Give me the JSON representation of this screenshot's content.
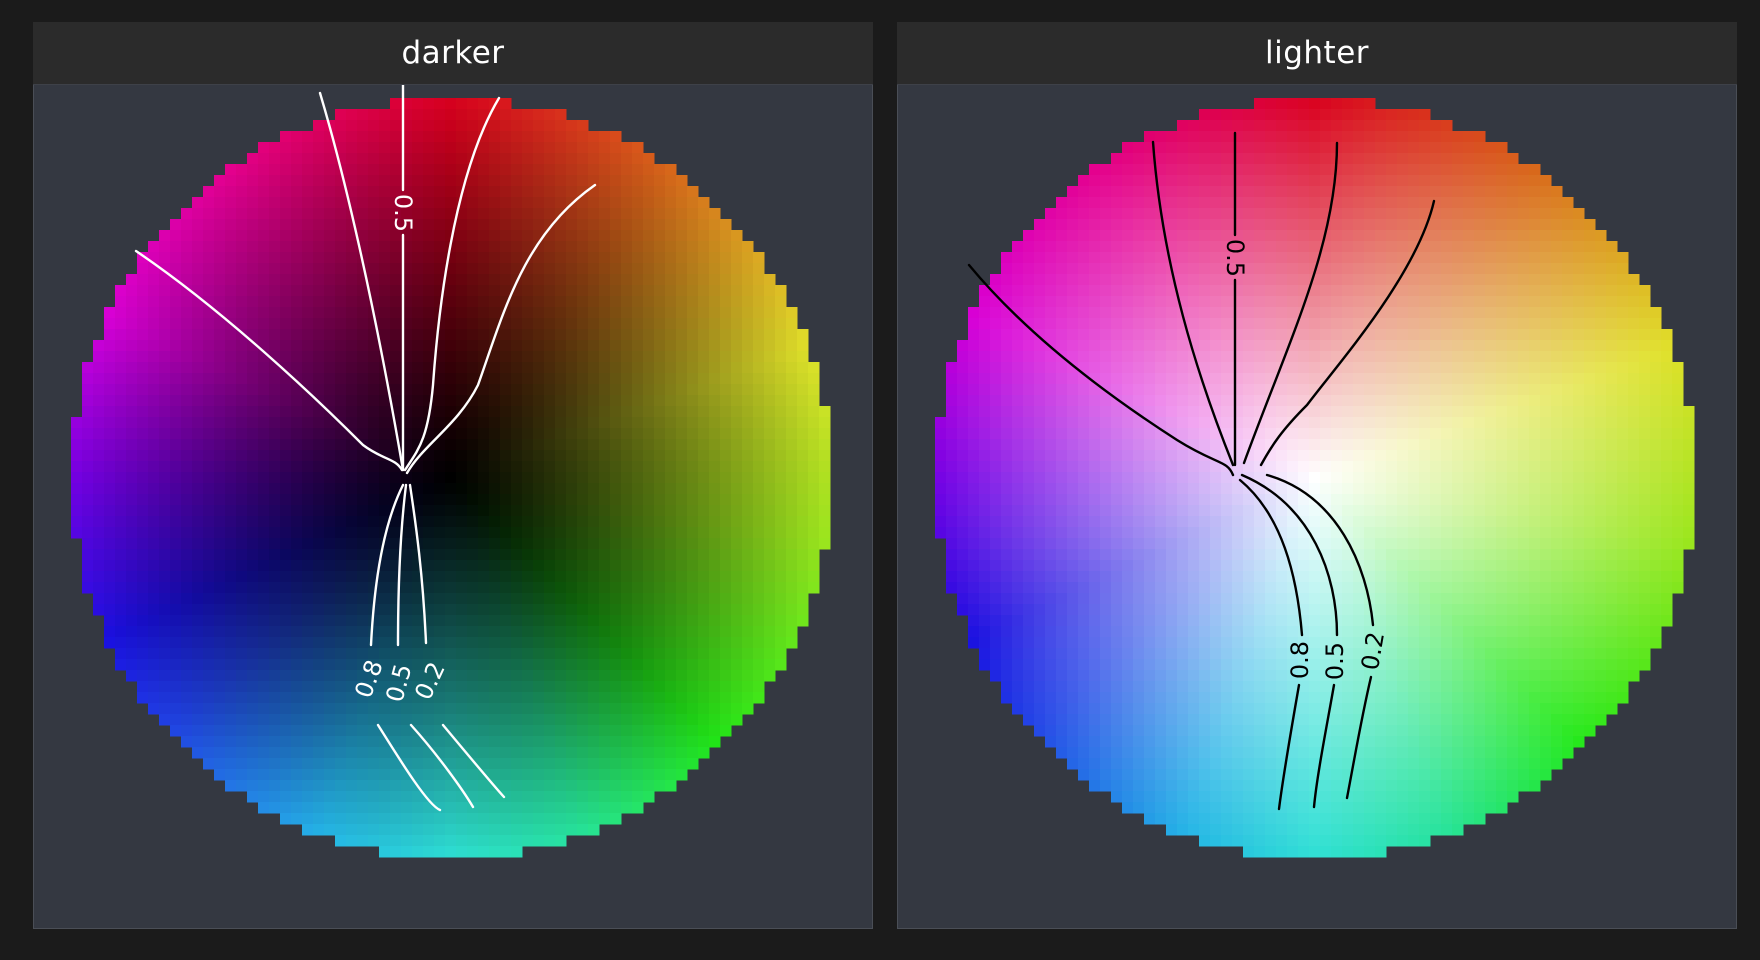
{
  "chart_data": [
    {
      "type": "heatmap",
      "title": "darker",
      "background": "dark",
      "contour_color": "#ffffff",
      "contour_labels": [
        {
          "text": "0.5",
          "rotate": 90
        },
        {
          "text": "0.8",
          "rotate": -70
        },
        {
          "text": "0.5",
          "rotate": -75
        },
        {
          "text": "0.2",
          "rotate": -65
        }
      ]
    },
    {
      "type": "heatmap",
      "title": "lighter",
      "background": "light",
      "contour_color": "#000000",
      "contour_labels": [
        {
          "text": "0.5",
          "rotate": 90
        },
        {
          "text": "0.8",
          "rotate": -90
        },
        {
          "text": "0.5",
          "rotate": -90
        },
        {
          "text": "0.2",
          "rotate": -80
        }
      ]
    }
  ],
  "hue_stops": [
    {
      "angle": 0,
      "color": "#d9001e"
    },
    {
      "angle": 35,
      "color": "#d8661a"
    },
    {
      "angle": 70,
      "color": "#e0e02a"
    },
    {
      "angle": 100,
      "color": "#9ae61e"
    },
    {
      "angle": 135,
      "color": "#22e818"
    },
    {
      "angle": 160,
      "color": "#27e39a"
    },
    {
      "angle": 180,
      "color": "#2edfd4"
    },
    {
      "angle": 200,
      "color": "#25b4e6"
    },
    {
      "angle": 228,
      "color": "#2145e6"
    },
    {
      "angle": 245,
      "color": "#1a10e0"
    },
    {
      "angle": 270,
      "color": "#7500e4"
    },
    {
      "angle": 295,
      "color": "#d800d6"
    },
    {
      "angle": 325,
      "color": "#e4008c"
    },
    {
      "angle": 360,
      "color": "#d9001e"
    }
  ]
}
